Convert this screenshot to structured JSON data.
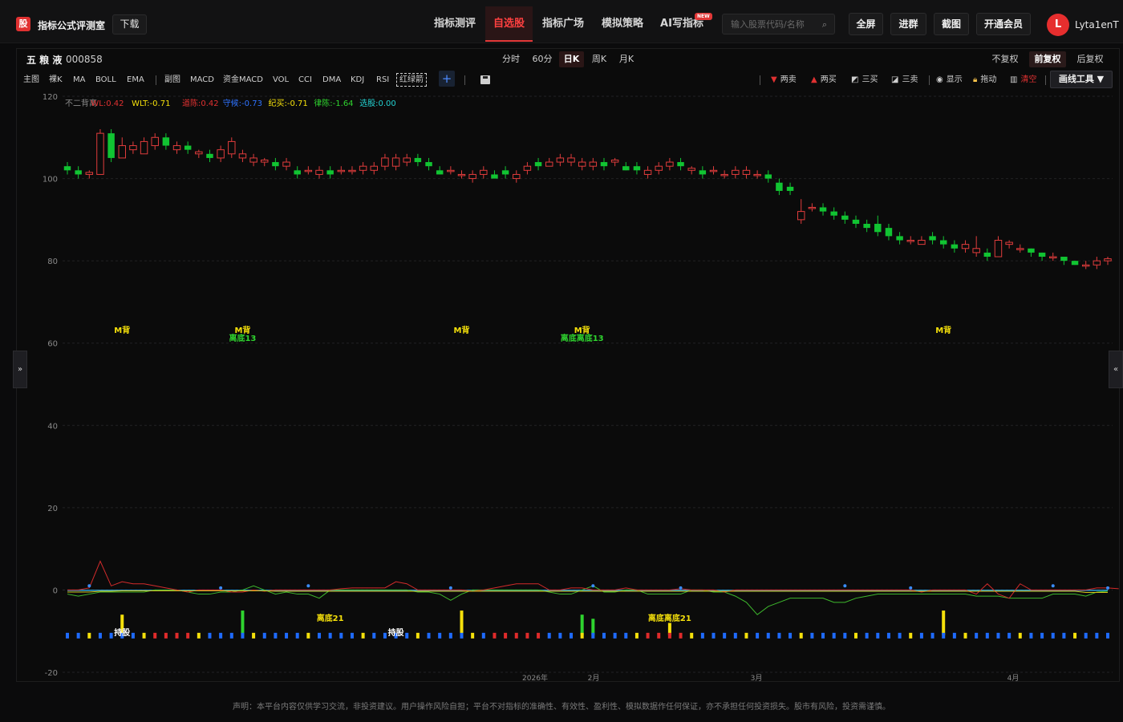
{
  "app": {
    "logo_char": "股",
    "brand": "指标公式评测室",
    "download": "下载"
  },
  "nav": [
    {
      "label": "指标测评",
      "active": false
    },
    {
      "label": "自选股",
      "active": true
    },
    {
      "label": "指标广场",
      "active": false
    },
    {
      "label": "模拟策略",
      "active": false
    },
    {
      "label": "AI写指标",
      "active": false,
      "badge": "NEW"
    }
  ],
  "search": {
    "placeholder": "输入股票代码/名称",
    "icon": "search-icon"
  },
  "header_buttons": [
    "全屏",
    "进群",
    "截图",
    "开通会员"
  ],
  "user": {
    "initial": "L",
    "name": "Lyta1enT"
  },
  "stock": {
    "name": "五 粮 液",
    "code": "000858"
  },
  "periods": [
    {
      "label": "分时",
      "active": false
    },
    {
      "label": "60分",
      "active": false
    },
    {
      "label": "日K",
      "active": true
    },
    {
      "label": "周K",
      "active": false
    },
    {
      "label": "月K",
      "active": false
    }
  ],
  "adjust": [
    {
      "label": "不复权",
      "active": false
    },
    {
      "label": "前复权",
      "active": true
    },
    {
      "label": "后复权",
      "active": false
    }
  ],
  "indicators": [
    "主图",
    "裸K",
    "MA",
    "BOLL",
    "EMA",
    "副图",
    "MACD",
    "资金MACD",
    "VOL",
    "CCI",
    "DMA",
    "KDJ",
    "RSI",
    "红绿箭"
  ],
  "tools": [
    {
      "label": "两卖",
      "icon": "triangle-down-icon",
      "color": "#e03131"
    },
    {
      "label": "两买",
      "icon": "triangle-up-icon",
      "color": "#e03131"
    },
    {
      "label": "三买",
      "icon": "chart-up-icon",
      "color": "#cfcfcf"
    },
    {
      "label": "三卖",
      "icon": "chart-down-icon",
      "color": "#cfcfcf"
    },
    {
      "label": "显示",
      "icon": "eye-icon",
      "color": "#cfcfcf"
    },
    {
      "label": "拖动",
      "icon": "lock-icon",
      "color": "#cfcfcf"
    },
    {
      "label": "清空",
      "icon": "trash-icon",
      "color": "#e03131"
    }
  ],
  "draw_tools": "画线工具 ▼",
  "indicator_legend": [
    {
      "label": "不二背离",
      "color": "#8a8a8a"
    },
    {
      "label": "WL:0.42",
      "color": "#e03131"
    },
    {
      "label": "WLT:-0.71",
      "color": "#f5e00b"
    },
    {
      "label": "道陈:0.42",
      "color": "#e03131"
    },
    {
      "label": "守候:-0.73",
      "color": "#2f73ff"
    },
    {
      "label": "纪买:-0.71",
      "color": "#f5e00b"
    },
    {
      "label": "律陈:-1.64",
      "color": "#2fd42f"
    },
    {
      "label": "选股:0.00",
      "color": "#23d1d1"
    }
  ],
  "chart_data": {
    "type": "candlestick",
    "ylim": [
      -20,
      120
    ],
    "yticks": [
      120,
      100,
      80,
      60,
      40,
      20,
      0,
      -20
    ],
    "xticks": [
      "2026年",
      "2月",
      "3月",
      "4月"
    ],
    "candles": [
      [
        103,
        102,
        104,
        101
      ],
      [
        102,
        101,
        103,
        100
      ],
      [
        101,
        101.5,
        102,
        100
      ],
      [
        101,
        111,
        112,
        101
      ],
      [
        111,
        105,
        112,
        104
      ],
      [
        105,
        108,
        110,
        105
      ],
      [
        107,
        108,
        109,
        106
      ],
      [
        106,
        109,
        110,
        106
      ],
      [
        108,
        110,
        111,
        107
      ],
      [
        110,
        108,
        111,
        107
      ],
      [
        107,
        108,
        109,
        106
      ],
      [
        108,
        107,
        109,
        106
      ],
      [
        106,
        106.5,
        107,
        105
      ],
      [
        106,
        105,
        107,
        104
      ],
      [
        105,
        107,
        108,
        104
      ],
      [
        106,
        109,
        110,
        105
      ],
      [
        105,
        106,
        107,
        104
      ],
      [
        104,
        105,
        106,
        103
      ],
      [
        104,
        104.5,
        105,
        103
      ],
      [
        104,
        103,
        105,
        102
      ],
      [
        103,
        104,
        105,
        102
      ],
      [
        102,
        101,
        103,
        100
      ],
      [
        102,
        102,
        103,
        101
      ],
      [
        101,
        102,
        103,
        100
      ],
      [
        102,
        101,
        103,
        100
      ],
      [
        102,
        102,
        103,
        101
      ],
      [
        102,
        102,
        103,
        101
      ],
      [
        102,
        103,
        104,
        101
      ],
      [
        102,
        103,
        104,
        101
      ],
      [
        103,
        105,
        106,
        102
      ],
      [
        103,
        105,
        106,
        102
      ],
      [
        104,
        105,
        106,
        103
      ],
      [
        105,
        104,
        106,
        103
      ],
      [
        104,
        103,
        105,
        102
      ],
      [
        102,
        101,
        103,
        101
      ],
      [
        102,
        102,
        103,
        101
      ],
      [
        101,
        101,
        102,
        100
      ],
      [
        100,
        101,
        102,
        99
      ],
      [
        101,
        102,
        103,
        100
      ],
      [
        101,
        100,
        102,
        100
      ],
      [
        102,
        101,
        103,
        100
      ],
      [
        100,
        101,
        102,
        99
      ],
      [
        102,
        103,
        104,
        101
      ],
      [
        104,
        103,
        105,
        102
      ],
      [
        103,
        104,
        105,
        103
      ],
      [
        104,
        105,
        106,
        103
      ],
      [
        104,
        105,
        106,
        103
      ],
      [
        103,
        104,
        105,
        102
      ],
      [
        103,
        104,
        105,
        102
      ],
      [
        104,
        103,
        105,
        102
      ],
      [
        104,
        104.5,
        105,
        103
      ],
      [
        103,
        102,
        104,
        102
      ],
      [
        103,
        102,
        104,
        101
      ],
      [
        101,
        102,
        103,
        100
      ],
      [
        102,
        103,
        104,
        101
      ],
      [
        103,
        104,
        105,
        102
      ],
      [
        104,
        103,
        105,
        102
      ],
      [
        102,
        102.5,
        103,
        101
      ],
      [
        102,
        101,
        103,
        100
      ],
      [
        102,
        102,
        103,
        101
      ],
      [
        101,
        101,
        102,
        100
      ],
      [
        101,
        102,
        103,
        100
      ],
      [
        101,
        102,
        103,
        100
      ],
      [
        101,
        101,
        102,
        100
      ],
      [
        101,
        100,
        102,
        99
      ],
      [
        99,
        97,
        100,
        96
      ],
      [
        98,
        97,
        99,
        96
      ],
      [
        90,
        92,
        95,
        89
      ],
      [
        93,
        93,
        94,
        92
      ],
      [
        93,
        92,
        94,
        91
      ],
      [
        92,
        91,
        93,
        90
      ],
      [
        91,
        90,
        92,
        89
      ],
      [
        90,
        89,
        91,
        88
      ],
      [
        89,
        88,
        90,
        87
      ],
      [
        89,
        87,
        91,
        86
      ],
      [
        88,
        86,
        89,
        85
      ],
      [
        86,
        85,
        87,
        84
      ],
      [
        85,
        85,
        86,
        84
      ],
      [
        84,
        85,
        86,
        84
      ],
      [
        86,
        85,
        87,
        84
      ],
      [
        85,
        84,
        86,
        83
      ],
      [
        84,
        83,
        85,
        82
      ],
      [
        83,
        84,
        85,
        82
      ],
      [
        82,
        83,
        86,
        81
      ],
      [
        82,
        81,
        83,
        80
      ],
      [
        81,
        85,
        86,
        81
      ],
      [
        84,
        84.5,
        85,
        83
      ],
      [
        83,
        83,
        84,
        82
      ],
      [
        83,
        82,
        83,
        81
      ],
      [
        82,
        81,
        82,
        80
      ],
      [
        81,
        81,
        82,
        80
      ],
      [
        81,
        80,
        81,
        79
      ],
      [
        80,
        79,
        80,
        79
      ],
      [
        79,
        79,
        80,
        78
      ],
      [
        79,
        80,
        81,
        78
      ],
      [
        80,
        80.5,
        81,
        79
      ]
    ],
    "labels": [
      {
        "text": "M背",
        "index": 5,
        "y": 62.5,
        "color": "#f5e00b"
      },
      {
        "text": "M背",
        "index": 16,
        "y": 62.5,
        "color": "#f5e00b"
      },
      {
        "text": "离底13",
        "index": 16,
        "y": 60.5,
        "color": "#2fd42f"
      },
      {
        "text": "M背",
        "index": 36,
        "y": 62.5,
        "color": "#f5e00b"
      },
      {
        "text": "M背",
        "index": 47,
        "y": 62.5,
        "color": "#f5e00b"
      },
      {
        "text": "离底离底13",
        "index": 47,
        "y": 60.5,
        "color": "#2fd42f"
      },
      {
        "text": "M背",
        "index": 80,
        "y": 62.5,
        "color": "#f5e00b"
      },
      {
        "text": "离底21",
        "index": 24,
        "y": -7.5,
        "color": "#f5e00b"
      },
      {
        "text": "离底离底21",
        "index": 55,
        "y": -7.5,
        "color": "#f5e00b"
      },
      {
        "text": "持股",
        "index": 5,
        "y": -11,
        "color": "#ffffff"
      },
      {
        "text": "持股",
        "index": 30,
        "y": -11,
        "color": "#ffffff"
      }
    ],
    "osc_red": [
      0,
      0,
      0.5,
      7,
      1,
      2,
      1.5,
      1.5,
      1,
      0.5,
      0,
      -0.5,
      0,
      0,
      0,
      -0.5,
      -0.5,
      0,
      -0.3,
      0,
      0,
      0,
      0,
      0,
      0,
      0.3,
      0.5,
      0.5,
      0.5,
      0.5,
      2,
      1.5,
      0,
      0,
      0,
      0,
      0,
      -0.3,
      0,
      0.5,
      1,
      1.5,
      1.5,
      1.5,
      0,
      0,
      0.5,
      0.5,
      0,
      0,
      0,
      0.5,
      0,
      0,
      0,
      0,
      0.3,
      0,
      0,
      0,
      -0.5,
      0,
      0,
      0,
      0,
      0,
      0,
      0,
      0,
      0,
      0,
      0,
      0,
      0,
      0,
      0,
      0,
      0,
      -0.5,
      0,
      0,
      0,
      0,
      -1,
      1.5,
      -1,
      -2,
      1.5,
      0,
      0,
      0,
      0,
      0,
      0,
      0.5,
      0.5,
      0.3
    ],
    "osc_green": [
      -1,
      -1.5,
      -1,
      -0.5,
      -0.5,
      -0.5,
      -0.5,
      -0.5,
      0,
      0,
      0,
      -0.5,
      -1,
      -1,
      -0.5,
      -0.5,
      0,
      1,
      0,
      -1,
      -0.5,
      -1,
      -1,
      -2,
      0,
      0,
      0,
      0,
      0,
      0,
      0,
      0,
      -0.5,
      -0.5,
      -1,
      -2.5,
      -1,
      0,
      0,
      0,
      0,
      0,
      0,
      0,
      -0.5,
      -1,
      -1,
      0,
      1,
      -0.5,
      -0.5,
      0,
      0,
      -1,
      -1,
      -1,
      -1,
      0,
      0,
      -0.5,
      -0.5,
      -1.5,
      -3,
      -6,
      -4,
      -3,
      -2,
      -2,
      -2,
      -2,
      -3,
      -3,
      -2,
      -1.5,
      -1,
      -1,
      -1,
      -1,
      -1,
      -1,
      -1,
      -1,
      -1,
      -1.5,
      -1.5,
      -1.5,
      -2,
      -2,
      -2,
      -2,
      -1,
      -1,
      -1,
      -1.5,
      -0.5,
      -0.3
    ],
    "osc_yellow": [
      -0.5,
      -0.5,
      -0.5,
      -0.3,
      -0.3,
      -0.2,
      -0.2,
      -0.2,
      -0.2,
      -0.2,
      -0.2,
      -0.2,
      -0.2,
      -0.2,
      -0.2,
      -0.2,
      -0.2,
      -0.2,
      -0.2,
      -0.3,
      -0.3,
      -0.3,
      -0.3,
      -0.3,
      -0.3,
      -0.3,
      -0.3,
      -0.3,
      -0.3,
      -0.3,
      -0.3,
      -0.3,
      -0.3,
      -0.3,
      -0.3,
      -0.3,
      -0.3,
      -0.3,
      -0.3,
      -0.3,
      -0.3,
      -0.3,
      -0.3,
      -0.3,
      -0.3,
      -0.3,
      -0.3,
      -0.3,
      -0.3,
      -0.3,
      -0.3,
      -0.3,
      -0.3,
      -0.3,
      -0.3,
      -0.3,
      -0.3,
      -0.3,
      -0.3,
      -0.3,
      -0.3,
      -0.3,
      -0.3,
      -0.3,
      -0.3,
      -0.3,
      -0.3,
      -0.3,
      -0.3,
      -0.3,
      -0.3,
      -0.3,
      -0.3,
      -0.3,
      -0.3,
      -0.3,
      -0.3,
      -0.3,
      -0.3,
      -0.3,
      -0.3,
      -0.3,
      -0.3,
      -0.3,
      -0.3,
      -0.3,
      -0.3,
      -0.3,
      -0.3,
      -0.3,
      -0.3,
      -0.3,
      -0.3,
      -0.6,
      -0.6,
      -0.6
    ],
    "buy_sell_bars": [
      {
        "index": 5,
        "h": 5,
        "color": "#f5e00b"
      },
      {
        "index": 16,
        "h": 6,
        "color": "#2fd42f"
      },
      {
        "index": 36,
        "h": 6,
        "color": "#f5e00b"
      },
      {
        "index": 47,
        "h": 5,
        "color": "#2fd42f"
      },
      {
        "index": 48,
        "h": 4,
        "color": "#2fd42f"
      },
      {
        "index": 55,
        "h": 3,
        "color": "#f5e00b"
      },
      {
        "index": 80,
        "h": 6,
        "color": "#f5e00b"
      }
    ]
  },
  "footer": "声明：本平台内容仅供学习交流，非投资建议。用户操作风险自担；平台不对指标的准确性、有效性、盈利性、模拟数据作任何保证，亦不承担任何投资损失。股市有风险，投资需谨慎。"
}
